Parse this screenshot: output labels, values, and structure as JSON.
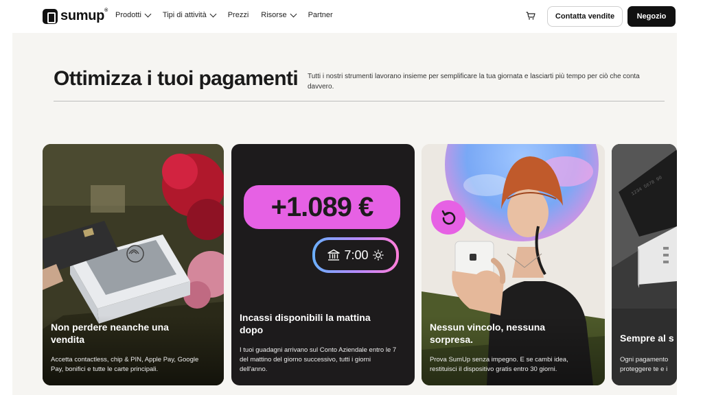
{
  "nav": {
    "logo_text": "sumup",
    "logo_reg": "®",
    "items": [
      {
        "label": "Prodotti",
        "has_dropdown": true
      },
      {
        "label": "Tipi di attività",
        "has_dropdown": true
      },
      {
        "label": "Prezzi",
        "has_dropdown": false
      },
      {
        "label": "Risorse",
        "has_dropdown": true
      },
      {
        "label": "Partner",
        "has_dropdown": false
      }
    ],
    "cart_icon": "cart-icon",
    "contact_button": "Contatta vendite",
    "shop_button": "Negozio"
  },
  "hero": {
    "title": "Ottimizza i tuoi pagamenti",
    "subtitle": "Tutti i nostri strumenti lavorano insieme per semplificare la tua giornata e lasciarti più tempo per ciò che conta davvero."
  },
  "cards": [
    {
      "title": "Non perdere neanche una vendita",
      "description": "Accetta contactless, chip & PIN, Apple Pay, Google Pay, bonifici e tutte le carte principali."
    },
    {
      "title": "Incassi disponibili la mattina dopo",
      "description": "I tuoi guadagni arrivano sul Conto Aziendale entro le 7 del mattino del giorno successivo, tutti i giorni dell'anno.",
      "amount": "+1.089 €",
      "time": "7:00"
    },
    {
      "title": "Nessun vincolo, nessuna sorpresa.",
      "description": "Prova SumUp senza impegno. E se cambi idea, restituisci il dispositivo gratis entro 30 giorni."
    },
    {
      "title": "Sempre al s",
      "description": "Ogni pagamento proteggere te e i"
    }
  ],
  "colors": {
    "accent_pink": "#e661e4",
    "dark": "#111111",
    "page_bg": "#f6f5f2"
  }
}
